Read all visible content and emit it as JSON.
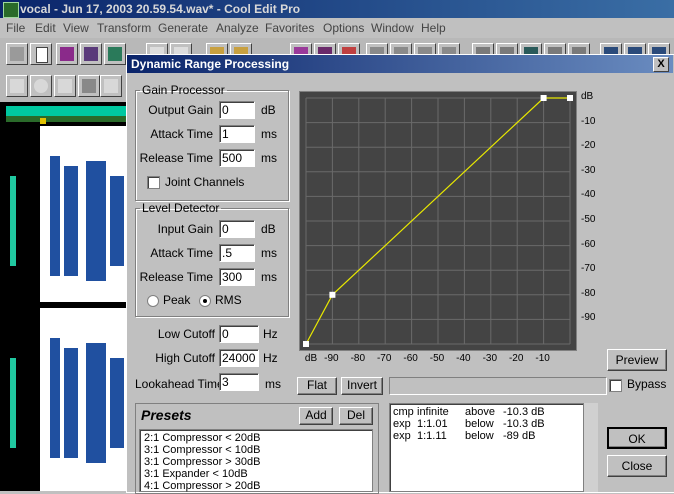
{
  "app": {
    "title": "vocal - Jun 17, 2003 20.59.54.wav* - Cool Edit Pro",
    "menu": [
      "File",
      "Edit",
      "View",
      "Transform",
      "Generate",
      "Analyze",
      "Favorites",
      "Options",
      "Window",
      "Help"
    ]
  },
  "dialog": {
    "title": "Dynamic Range Processing",
    "close_label": "X",
    "gain_processor": {
      "legend": "Gain Processor",
      "output_gain": {
        "label": "Output Gain",
        "value": "0",
        "unit": "dB"
      },
      "attack_time": {
        "label": "Attack Time",
        "value": "1",
        "unit": "ms"
      },
      "release_time": {
        "label": "Release Time",
        "value": "500",
        "unit": "ms"
      },
      "joint_channels": {
        "label": "Joint Channels",
        "checked": false
      }
    },
    "level_detector": {
      "legend": "Level Detector",
      "input_gain": {
        "label": "Input Gain",
        "value": "0",
        "unit": "dB"
      },
      "attack_time": {
        "label": "Attack Time",
        "value": ".5",
        "unit": "ms"
      },
      "release_time": {
        "label": "Release Time",
        "value": "300",
        "unit": "ms"
      },
      "peak_label": "Peak",
      "rms_label": "RMS",
      "mode": "RMS"
    },
    "low_cutoff": {
      "label": "Low Cutoff",
      "value": "0",
      "unit": "Hz"
    },
    "high_cutoff": {
      "label": "High Cutoff",
      "value": "24000",
      "unit": "Hz"
    },
    "lookahead": {
      "label": "Lookahead Time",
      "value": "3",
      "unit": "ms"
    },
    "graph": {
      "y_ticks": [
        "dB",
        "-10",
        "-20",
        "-30",
        "-40",
        "-50",
        "-60",
        "-70",
        "-80",
        "-90"
      ],
      "x_ticks": [
        "dB",
        "-90",
        "-80",
        "-70",
        "-60",
        "-50",
        "-40",
        "-30",
        "-20",
        "-10"
      ],
      "curve_points": [
        {
          "input": -100,
          "output": -100
        },
        {
          "input": -90,
          "output": -80
        },
        {
          "input": -10,
          "output": 0
        },
        {
          "input": 0,
          "output": 0
        }
      ],
      "curve_color": "#e8e800",
      "background_color": "#444444",
      "grid_color": "#6a6a6a"
    },
    "flat_label": "Flat",
    "invert_label": "Invert",
    "presets": {
      "title": "Presets",
      "add_label": "Add",
      "del_label": "Del",
      "items": [
        "2:1 Compressor < 20dB",
        "3:1 Compressor < 10dB",
        "3:1 Compressor > 30dB",
        "3:1 Expander < 10dB",
        "4:1 Compressor > 20dB"
      ]
    },
    "rules": [
      {
        "type": "cmp",
        "ratio": "infinite",
        "dir": "above",
        "level": "-10.3 dB"
      },
      {
        "type": "exp",
        "ratio": "1:1.01",
        "dir": "below",
        "level": "-10.3 dB"
      },
      {
        "type": "exp",
        "ratio": "1:1.11",
        "dir": "below",
        "level": "-89 dB"
      }
    ],
    "preview_label": "Preview",
    "bypass_label": "Bypass",
    "ok_label": "OK",
    "close_label2": "Close"
  }
}
